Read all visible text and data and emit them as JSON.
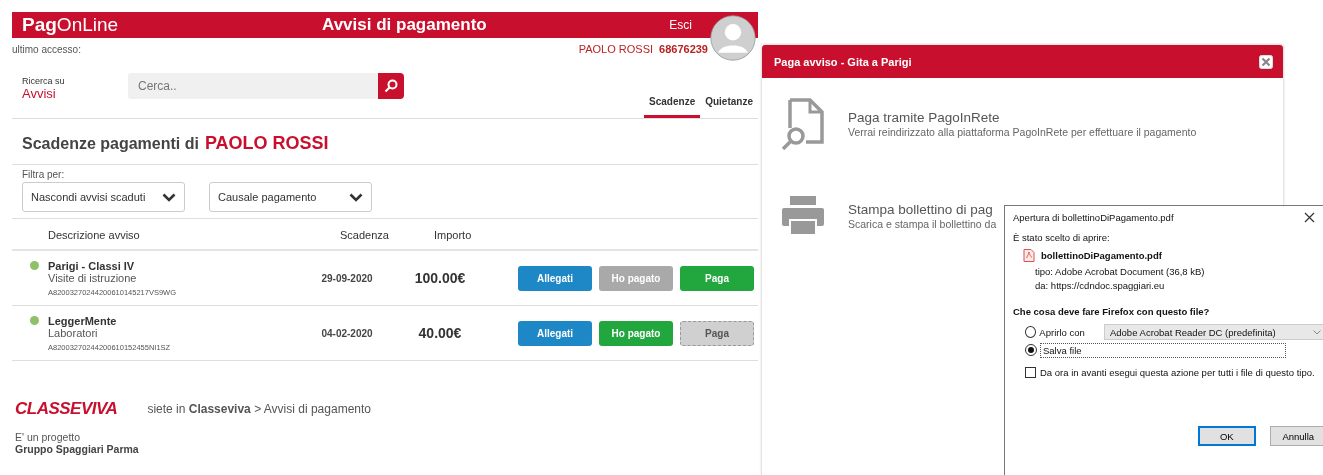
{
  "page": {
    "header": {
      "logo_bold": "Pag",
      "logo_light": "OnLine",
      "title": "Avvisi di pagamento",
      "logout": "Esci"
    },
    "last_access": "ultimo accesso:",
    "user": {
      "name": "PAOLO ROSSI",
      "code": "68676239"
    },
    "search": {
      "label": "Ricerca su",
      "scope": "Avvisi",
      "placeholder": "Cerca.."
    },
    "tabs": [
      {
        "label": "Scadenze",
        "selected": true
      },
      {
        "label": "Quietanze",
        "selected": false
      }
    ],
    "heading": {
      "text": "Scadenze pagamenti di",
      "name": "PAOLO ROSSI"
    },
    "filter_label": "Filtra per:",
    "filters": [
      "Nascondi avvisi scaduti",
      "Causale pagamento"
    ],
    "table": {
      "columns": [
        "Descrizione avviso",
        "Scadenza",
        "Importo"
      ],
      "rows": [
        {
          "title": "Parigi - Classi IV",
          "category": "Visite di istruzione",
          "code": "A82003270244200610145217VS9WG",
          "due": "29-09-2020",
          "amount": "100.00€",
          "color": "#8fc06a",
          "buttons": [
            {
              "label": "Allegati",
              "kind": "attachments",
              "disabled": false
            },
            {
              "label": "Ho pagato",
              "kind": "paid",
              "disabled": true
            },
            {
              "label": "Paga",
              "kind": "pay",
              "disabled": false
            }
          ]
        },
        {
          "title": "LeggerMente",
          "category": "Laboratori",
          "code": "A82003270244200610152455NI1SZ",
          "due": "04-02-2020",
          "amount": "40.00€",
          "color": "#8fc06a",
          "buttons": [
            {
              "label": "Allegati",
              "kind": "attachments",
              "disabled": false
            },
            {
              "label": "Ho pagato",
              "kind": "paid",
              "disabled": false
            },
            {
              "label": "Paga",
              "kind": "pay",
              "disabled": true
            }
          ]
        }
      ]
    },
    "footer": {
      "logo": "CLASSEVIVA",
      "breadcrumb": "siete in **Classeviva** > Avvisi di pagamento",
      "credit": "E' un progetto",
      "company": "Gruppo Spaggiari Parma"
    }
  },
  "modal": {
    "title": "Paga avviso - Gita a Parigi",
    "options": [
      {
        "kind": "online",
        "title": "Paga tramite PagoInRete",
        "description": "Verrai reindirizzato alla piattaforma PagoInRete per effettuare il pagamento"
      },
      {
        "kind": "print",
        "title": "Stampa bollettino di pag",
        "description": "Scarica e stampa il bollettino da"
      }
    ]
  },
  "download_dialog": {
    "title": "Apertura di bollettinoDiPagamento.pdf",
    "intro": "È stato scelto di aprire:",
    "file": "bollettinoDiPagamento.pdf",
    "type": "tipo:  Adobe Acrobat Document (36,8 kB)",
    "source": "da:  https://cdndoc.spaggiari.eu",
    "question": "Che cosa deve fare Firefox con questo file?",
    "choices": [
      {
        "label": "Aprirlo con",
        "selected": false,
        "app": "Adobe Acrobat Reader DC (predefinita)"
      },
      {
        "label": "Salva file",
        "selected": true
      }
    ],
    "remember": {
      "label": "Da ora in avanti esegui questa azione per tutti i file di questo tipo.",
      "checked": false
    },
    "buttons": [
      "OK",
      "Annulla"
    ]
  }
}
